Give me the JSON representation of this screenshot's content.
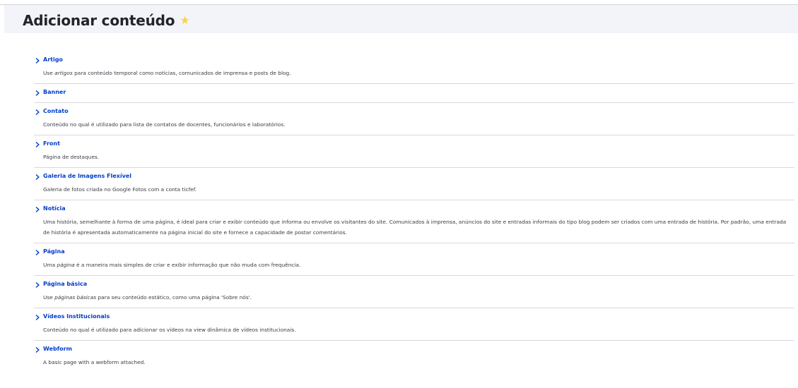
{
  "page": {
    "title": "Adicionar conteúdo",
    "star_icon": "star-icon"
  },
  "items": [
    {
      "label": "Artigo",
      "desc_before": "Use ",
      "desc_em": "artigos",
      "desc_after": " para conteúdo temporal como notícias, comunicados de imprensa e posts de blog."
    },
    {
      "label": "Banner",
      "desc_before": "",
      "desc_em": "",
      "desc_after": ""
    },
    {
      "label": "Contato",
      "desc_before": "Conteúdo no qual é utilizado para lista de contatos de docentes, funcionários e laboratórios.",
      "desc_em": "",
      "desc_after": ""
    },
    {
      "label": "Front",
      "desc_before": "Página de destaques.",
      "desc_em": "",
      "desc_after": ""
    },
    {
      "label": "Galeria de Imagens Flexível",
      "desc_before": "Galeria de fotos criada no Google Fotos com a conta ticfef.",
      "desc_em": "",
      "desc_after": ""
    },
    {
      "label": "Notícia",
      "desc_before": "Uma história, semelhante à forma de uma página, é ideal para criar e exibir conteúdo que informa ou envolve os visitantes do site. Comunicados à imprensa, anúncios do site e entradas informais do tipo blog podem ser criados com uma entrada de história. Por padrão, uma entrada de história é apresentada automaticamente na página inicial do site e fornece a capacidade de postar comentários.",
      "desc_em": "",
      "desc_after": ""
    },
    {
      "label": "Página",
      "desc_before": "Uma ",
      "desc_em": "página",
      "desc_after": " é a maneira mais simples de criar e exibir informação que não muda com frequência."
    },
    {
      "label": "Página básica",
      "desc_before": "Use ",
      "desc_em": "páginas básicas",
      "desc_after": " para seu conteúdo estático, como uma página 'Sobre nós'."
    },
    {
      "label": "Vídeos Institucionais",
      "desc_before": "Conteúdo no qual é utilizado para adicionar os vídeos na view dinâmica de vídeos institucionais.",
      "desc_em": "",
      "desc_after": ""
    },
    {
      "label": "Webform",
      "desc_before": "A basic page with a webform attached.",
      "desc_em": "",
      "desc_after": ""
    }
  ]
}
